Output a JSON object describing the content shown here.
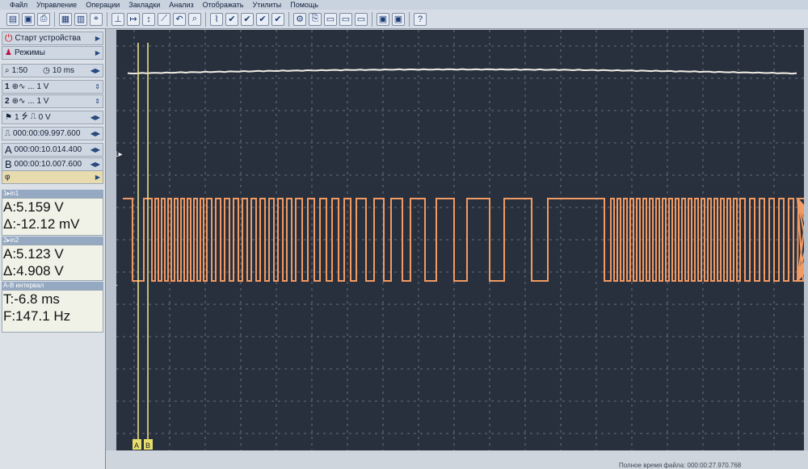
{
  "menu": [
    "Файл",
    "Управление",
    "Операции",
    "Закладки",
    "Анализ",
    "Отображать",
    "Утилиты",
    "Помощь"
  ],
  "toolbar_icons": [
    "open-icon",
    "save-icon",
    "print-icon",
    "grid-icon",
    "layout-icon",
    "cursor-icon",
    "marker-icon",
    "measure-icon",
    "scale-icon",
    "trend-icon",
    "undo-icon",
    "zoom-icon",
    "pin-icon",
    "check-icon",
    "check-icon",
    "check-icon",
    "check-icon",
    "gear-icon",
    "copy-icon",
    "display-icon",
    "display-icon",
    "display-icon",
    "window-icon",
    "window-icon",
    "help-icon"
  ],
  "sidebar": {
    "start_device": "Старт устройства",
    "modes": "Режимы",
    "sweep_scale": "1:50",
    "sweep_time": "10 ms",
    "ch1_label": "1",
    "ch1_scale": "... 1 V",
    "ch2_label": "2",
    "ch2_scale": "... 1 V",
    "trigger_channel": "1",
    "trigger_level": "0 V",
    "time_pos": "000:00:09.997.600",
    "cursor_a_label": "A",
    "cursor_a": "000:00:10.014.400",
    "cursor_b_label": "B",
    "cursor_b": "000:00:10.007.600",
    "phi": "φ",
    "in1_title": "1▸in1",
    "in1_a": "A:5.159 V",
    "in1_delta": "Δ:-12.12 mV",
    "in2_title": "2▸in2",
    "in2_a": "A:5.123 V",
    "in2_delta": "Δ:4.908 V",
    "ab_title": "A-B интервал",
    "ab_t": "T:-6.8 ms",
    "ab_f": "F:147.1 Hz"
  },
  "scope": {
    "ch1_marker": "1▸",
    "ch2_marker": "2▸",
    "cursor_a_tag": "A",
    "cursor_b_tag": "B",
    "ch1_color": "#f2eee6",
    "ch2_color": "#f29a63",
    "grid_color": "#9ea7b5"
  },
  "status": {
    "label": "Полное время файла: 000:00:27.970.768"
  }
}
